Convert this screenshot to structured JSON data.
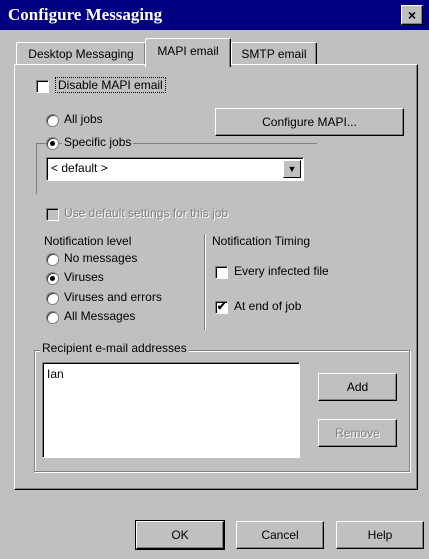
{
  "window": {
    "title": "Configure Messaging",
    "close_glyph": "×"
  },
  "tabs": [
    {
      "label": "Desktop Messaging",
      "active": false
    },
    {
      "label": "MAPI email",
      "active": true
    },
    {
      "label": "SMTP email",
      "active": false
    }
  ],
  "mapi": {
    "disable_label": "Disable MAPI email",
    "disable_checked": false,
    "all_jobs_label": "All jobs",
    "specific_jobs_label": "Specific jobs",
    "selected_job_mode": "specific",
    "configure_button": "Configure MAPI...",
    "job_select_value": "< default >",
    "use_default_label": "Use default settings for this job",
    "use_default_checked": false,
    "use_default_disabled": true
  },
  "notification_level": {
    "title": "Notification level",
    "options": [
      {
        "label": "No messages",
        "selected": false
      },
      {
        "label": "Viruses",
        "selected": true
      },
      {
        "label": "Viruses and errors",
        "selected": false
      },
      {
        "label": "All Messages",
        "selected": false
      }
    ]
  },
  "notification_timing": {
    "title": "Notification Timing",
    "every_infected_label": "Every infected file",
    "every_infected_checked": false,
    "end_of_job_label": "At end of job",
    "end_of_job_checked": true
  },
  "recipients": {
    "title": "Recipient e-mail addresses",
    "list": [
      "Ian"
    ],
    "add_button": "Add",
    "remove_button": "Remove"
  },
  "footer": {
    "ok_button": "OK",
    "cancel_button": "Cancel",
    "help_button": "Help"
  },
  "icons": {
    "check_glyph": "✔",
    "dropdown_glyph": "▼"
  }
}
